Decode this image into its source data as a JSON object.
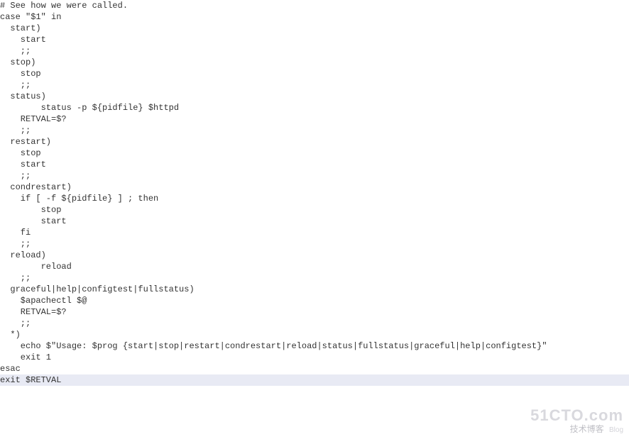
{
  "code": {
    "l1": "# See how we were called.",
    "l2": "case \"$1\" in",
    "l3": "  start)",
    "l4": "    start",
    "l5": "    ;;",
    "l6": "  stop)",
    "l7": "    stop",
    "l8": "    ;;",
    "l9": "  status)",
    "l10": "        status -p ${pidfile} $httpd",
    "l11": "    RETVAL=$?",
    "l12": "    ;;",
    "l13": "  restart)",
    "l14": "    stop",
    "l15": "    start",
    "l16": "    ;;",
    "l17": "  condrestart)",
    "l18": "    if [ -f ${pidfile} ] ; then",
    "l19": "        stop",
    "l20": "        start",
    "l21": "    fi",
    "l22": "    ;;",
    "l23": "  reload)",
    "l24": "        reload",
    "l25": "    ;;",
    "l26": "  graceful|help|configtest|fullstatus)",
    "l27": "    $apachectl $@",
    "l28": "    RETVAL=$?",
    "l29": "    ;;",
    "l30": "  *)",
    "l31": "    echo $\"Usage: $prog {start|stop|restart|condrestart|reload|status|fullstatus|graceful|help|configtest}\"",
    "l32": "    exit 1",
    "l33": "esac",
    "l34": "exit $RETVAL"
  },
  "watermark": {
    "main": "51CTO.com",
    "sub": "技术博客",
    "blog": "Blog"
  }
}
